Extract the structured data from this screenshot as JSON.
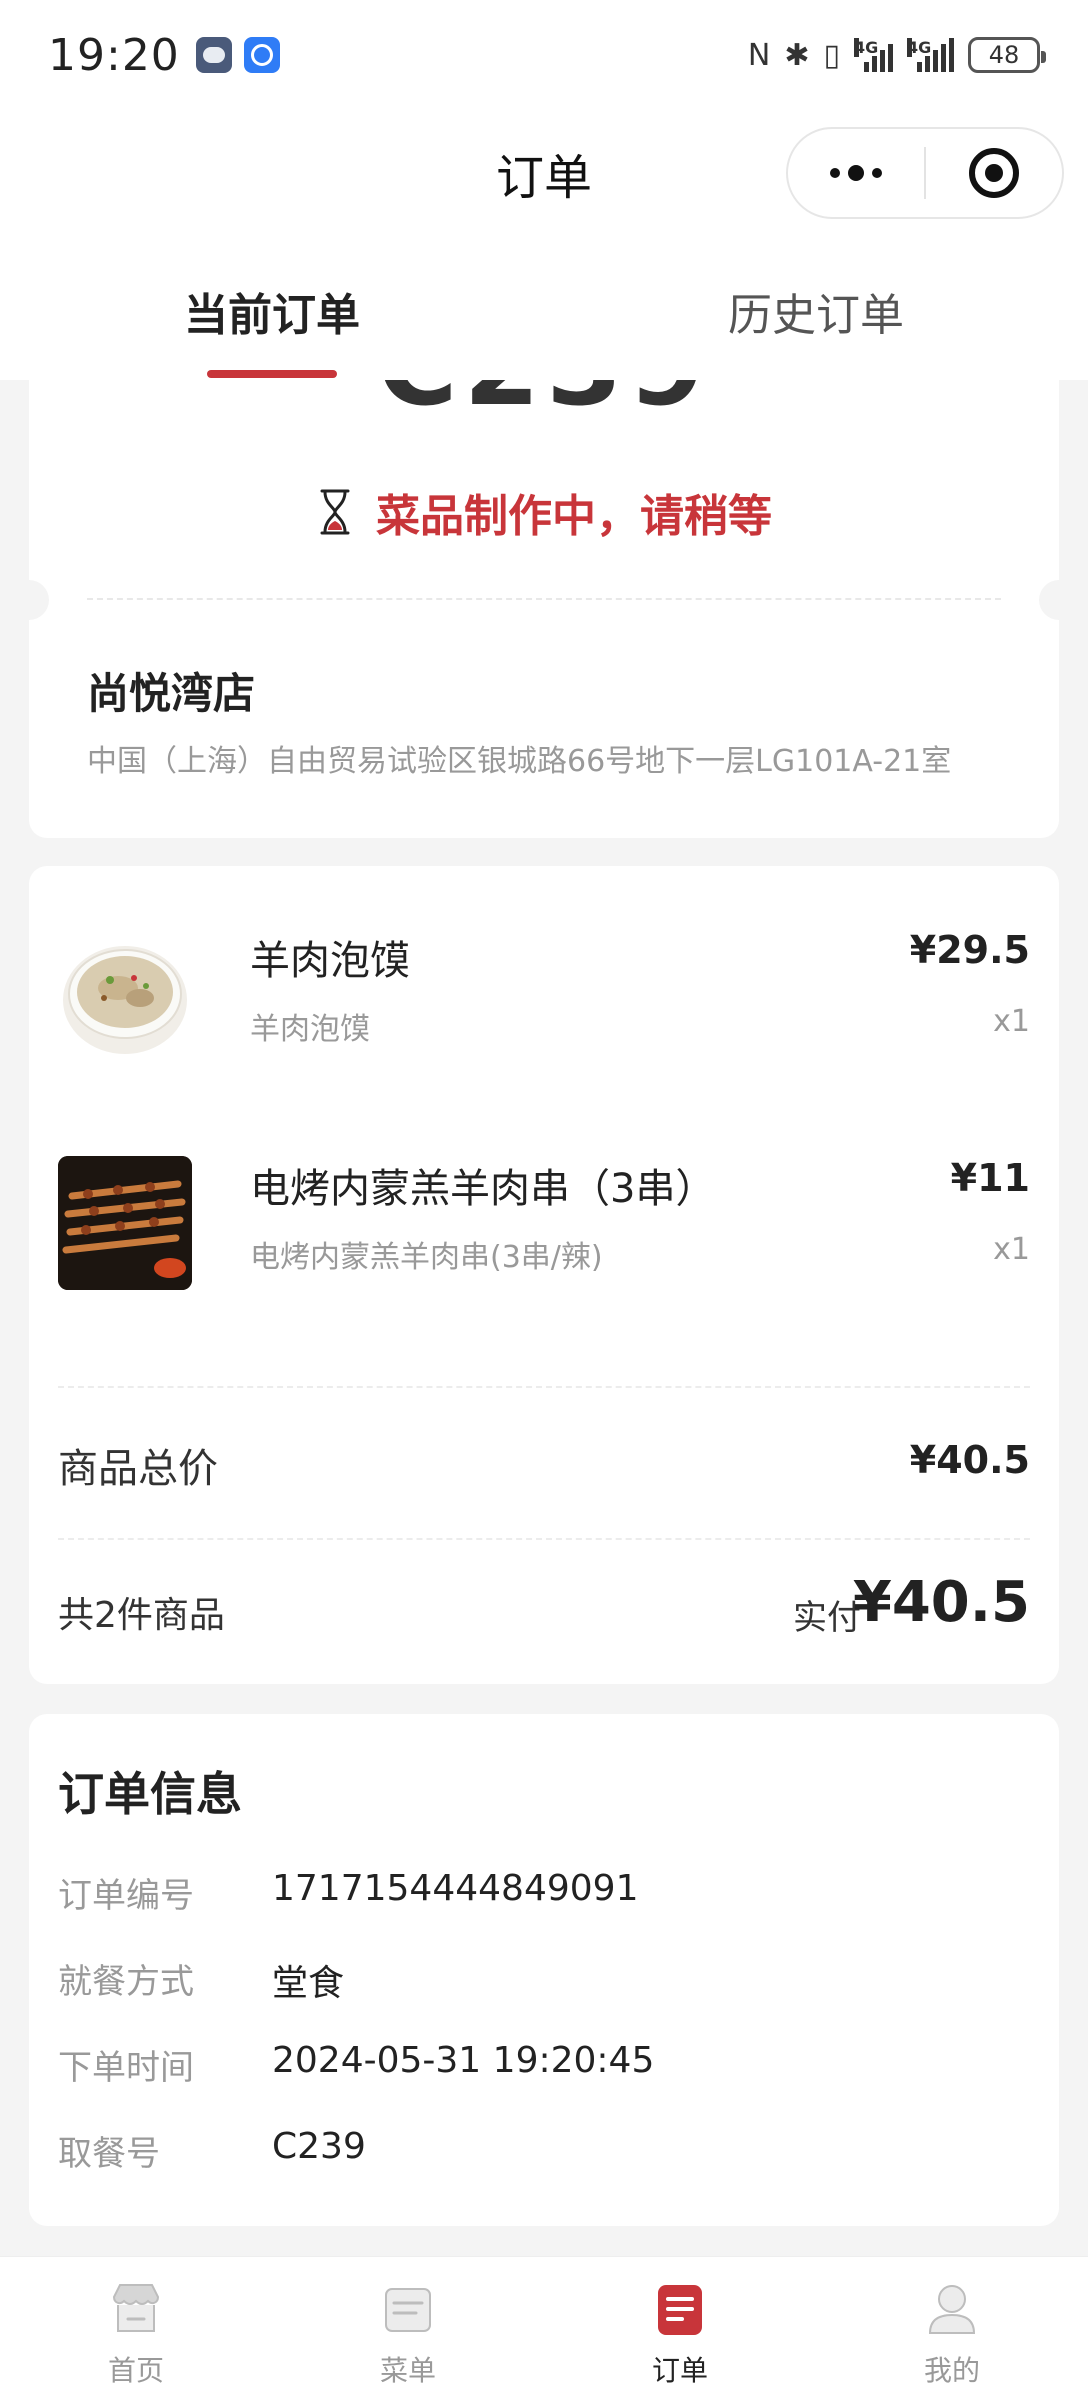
{
  "status_bar": {
    "time": "19:20",
    "nfc_icon": "N",
    "bluetooth_icon": "✱",
    "vibrate_icon": "▯",
    "network_1": "4G",
    "network_2": "4G",
    "battery": "48"
  },
  "nav": {
    "title": "订单"
  },
  "tabs": [
    {
      "label": "当前订单",
      "active": true
    },
    {
      "label": "历史订单",
      "active": false
    }
  ],
  "order_status": {
    "pickup_code_partial": "C239",
    "status_text": "菜品制作中，请稍等"
  },
  "store": {
    "name": "尚悦湾店",
    "address": "中国（上海）自由贸易试验区银城路66号地下一层LG101A-21室"
  },
  "items": [
    {
      "name": "羊肉泡馍",
      "spec": "羊肉泡馍",
      "price": "¥29.5",
      "qty": "x1",
      "thumb": "soup-bowl"
    },
    {
      "name": "电烤内蒙羔羊肉串（3串）",
      "spec": "电烤内蒙羔羊肉串(3串/辣)",
      "price": "¥11",
      "qty": "x1",
      "thumb": "lamb-skewers"
    }
  ],
  "summary": {
    "total_label": "商品总价",
    "total_value": "¥40.5",
    "count_label": "共2件商品",
    "paid_label": "实付",
    "paid_value": "¥40.5"
  },
  "order_info": {
    "title": "订单信息",
    "rows": [
      {
        "key": "订单编号",
        "value": "1717154444849091"
      },
      {
        "key": "就餐方式",
        "value": "堂食"
      },
      {
        "key": "下单时间",
        "value": "2024-05-31 19:20:45"
      },
      {
        "key": "取餐号",
        "value": "C239"
      }
    ]
  },
  "tabbar": [
    {
      "label": "首页",
      "icon": "store-icon",
      "active": false
    },
    {
      "label": "菜单",
      "icon": "menu-icon",
      "active": false
    },
    {
      "label": "订单",
      "icon": "order-icon",
      "active": true
    },
    {
      "label": "我的",
      "icon": "profile-icon",
      "active": false
    }
  ],
  "colors": {
    "accent": "#c8353a",
    "background": "#f4f4f4"
  }
}
